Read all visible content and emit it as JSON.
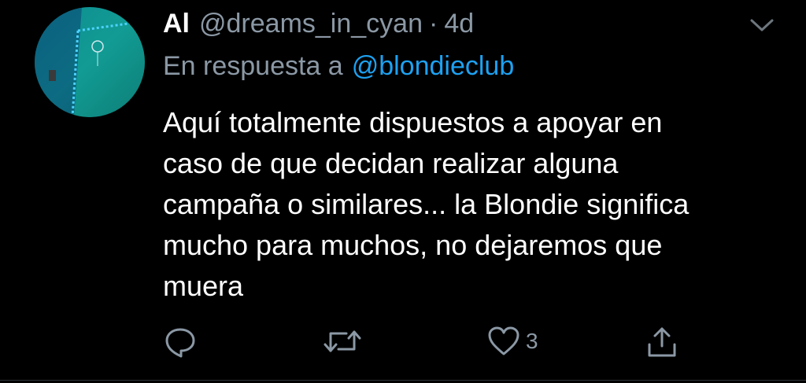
{
  "tweet": {
    "display_name": "Al",
    "handle": "@dreams_in_cyan",
    "separator": "·",
    "time": "4d",
    "reply_prefix": "En respuesta a",
    "reply_mention": "@blondieclub",
    "text_lines": [
      "Aquí totalmente dispuestos a apoyar en",
      "caso de que decidan realizar alguna",
      "campaña o similares... la Blondie significa",
      "mucho para muchos, no dejaremos que",
      "muera"
    ],
    "like_count": "3"
  },
  "icons": {
    "reply": "speech-bubble-icon",
    "retweet": "retweet-icon",
    "like": "heart-icon",
    "share": "share-icon",
    "menu": "chevron-down-icon"
  },
  "colors": {
    "background": "#000000",
    "primary_text": "#ffffff",
    "secondary_text": "#8b98a5",
    "link": "#1da1f2"
  }
}
